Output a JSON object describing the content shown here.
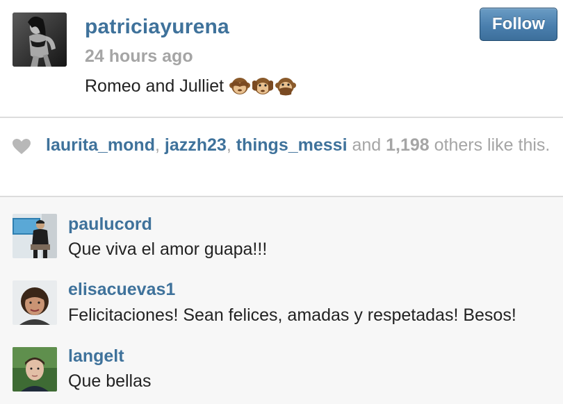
{
  "post": {
    "username": "patriciayurena",
    "timestamp": "24 hours ago",
    "caption": "Romeo and Julliet",
    "caption_emoji_icons": [
      "see-no-evil-monkey-icon",
      "hear-no-evil-monkey-icon",
      "speak-no-evil-monkey-icon"
    ],
    "follow_label": "Follow"
  },
  "likes": {
    "likers": [
      "laurita_mond",
      "jazzh23",
      "things_messi"
    ],
    "separator": ", ",
    "and_text": " and ",
    "count": "1,198",
    "suffix": " others like this."
  },
  "comments": [
    {
      "username": "paulucord",
      "text": "Que viva el amor guapa!!!"
    },
    {
      "username": "elisacuevas1",
      "text": "Felicitaciones! Sean felices, amadas y respetadas! Besos!"
    },
    {
      "username": "langelt",
      "text": "Que bellas"
    }
  ],
  "colors": {
    "link_blue": "#3f729b",
    "muted_gray": "#a5a5a5",
    "follow_button": "#4a7fae",
    "comments_background": "#f7f7f7"
  }
}
